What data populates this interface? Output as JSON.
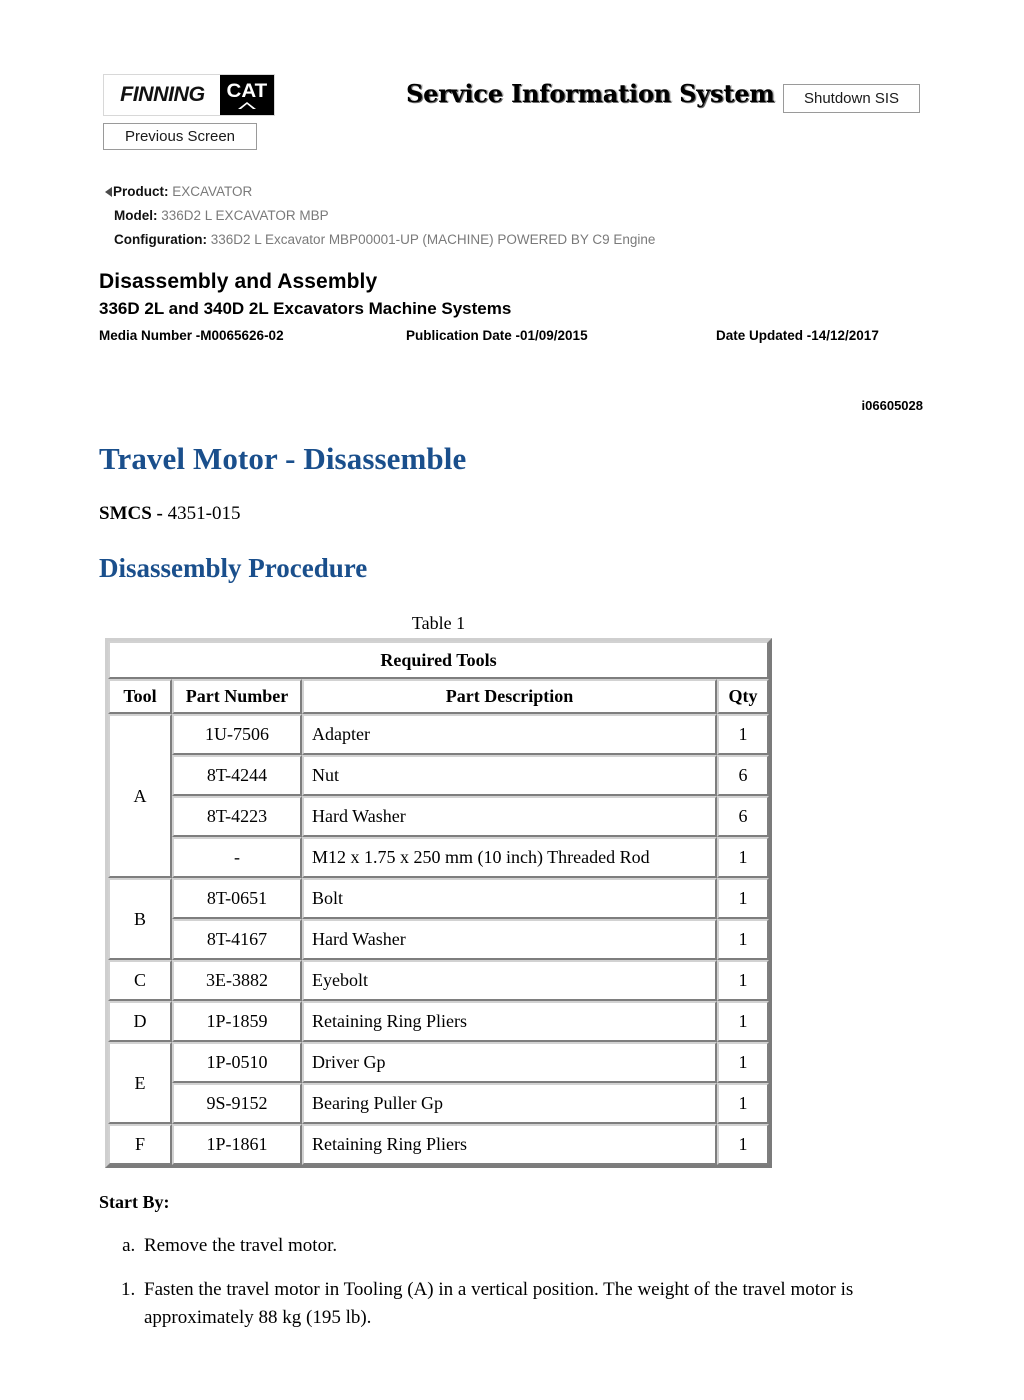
{
  "header": {
    "logo_finning": "FINNING",
    "logo_cat": "CAT",
    "sis_title": "Service Information System",
    "shutdown_button": "Shutdown SIS",
    "previous_button": "Previous Screen"
  },
  "meta": {
    "product_label": "Product:",
    "product_value": "EXCAVATOR",
    "model_label": "Model:",
    "model_value": "336D2 L EXCAVATOR MBP",
    "configuration_label": "Configuration:",
    "configuration_value": "336D2 L Excavator MBP00001-UP (MACHINE) POWERED BY C9 Engine"
  },
  "document": {
    "title": "Disassembly and Assembly",
    "subtitle": "336D 2L and 340D 2L Excavators Machine Systems",
    "media_number": "Media Number -M0065626-02",
    "publication_date": "Publication Date -01/09/2015",
    "date_updated": "Date Updated -14/12/2017",
    "doc_id": "i06605028"
  },
  "content": {
    "heading": "Travel Motor - Disassemble",
    "smcs_label": "SMCS -",
    "smcs_value": "4351-015",
    "procedure_heading": "Disassembly Procedure",
    "table_caption": "Table 1",
    "start_by_label": "Start By:",
    "start_by_items": [
      "Remove the travel motor."
    ],
    "steps": [
      "Fasten the travel motor in Tooling (A) in a vertical position. The weight of the travel motor is approximately 88 kg (195 lb)."
    ]
  },
  "table": {
    "title": "Required Tools",
    "columns": {
      "tool": "Tool",
      "part_number": "Part Number",
      "part_description": "Part Description",
      "qty": "Qty"
    },
    "rows": [
      {
        "tool": "A",
        "rowspan": 4,
        "part_number": "1U-7506",
        "part_description": "Adapter",
        "qty": "1"
      },
      {
        "tool": "",
        "rowspan": 0,
        "part_number": "8T-4244",
        "part_description": "Nut",
        "qty": "6"
      },
      {
        "tool": "",
        "rowspan": 0,
        "part_number": "8T-4223",
        "part_description": "Hard Washer",
        "qty": "6"
      },
      {
        "tool": "",
        "rowspan": 0,
        "part_number": "-",
        "part_description": "M12 x 1.75 x 250 mm (10 inch) Threaded Rod",
        "qty": "1"
      },
      {
        "tool": "B",
        "rowspan": 2,
        "part_number": "8T-0651",
        "part_description": "Bolt",
        "qty": "1"
      },
      {
        "tool": "",
        "rowspan": 0,
        "part_number": "8T-4167",
        "part_description": "Hard Washer",
        "qty": "1"
      },
      {
        "tool": "C",
        "rowspan": 1,
        "part_number": "3E-3882",
        "part_description": "Eyebolt",
        "qty": "1"
      },
      {
        "tool": "D",
        "rowspan": 1,
        "part_number": "1P-1859",
        "part_description": "Retaining Ring Pliers",
        "qty": "1"
      },
      {
        "tool": "E",
        "rowspan": 2,
        "part_number": "1P-0510",
        "part_description": "Driver Gp",
        "qty": "1"
      },
      {
        "tool": "",
        "rowspan": 0,
        "part_number": "9S-9152",
        "part_description": "Bearing Puller Gp",
        "qty": "1"
      },
      {
        "tool": "F",
        "rowspan": 1,
        "part_number": "1P-1861",
        "part_description": "Retaining Ring Pliers",
        "qty": "1"
      }
    ]
  },
  "colors": {
    "heading_blue": "#1a4f8c",
    "meta_value_gray": "#7a7a7a",
    "button_border": "#9a9a9a"
  }
}
